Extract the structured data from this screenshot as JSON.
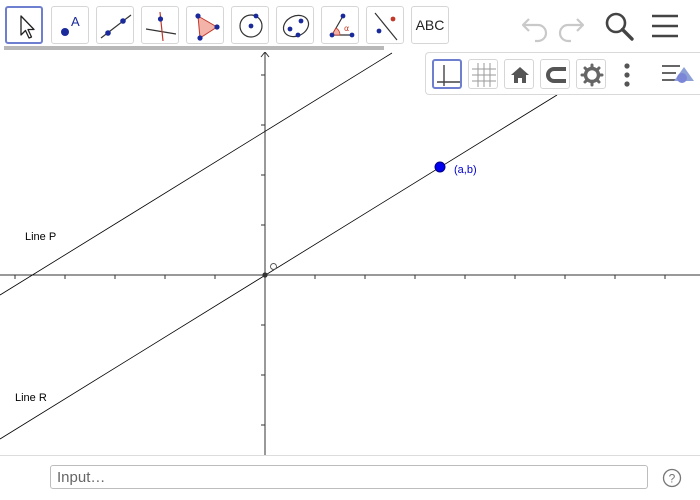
{
  "toolbar": {
    "tools": [
      {
        "name": "move-tool"
      },
      {
        "name": "point-tool"
      },
      {
        "name": "line-tool"
      },
      {
        "name": "perpendicular-line-tool"
      },
      {
        "name": "polygon-tool"
      },
      {
        "name": "circle-tool"
      },
      {
        "name": "conic-tool"
      },
      {
        "name": "angle-tool"
      },
      {
        "name": "reflect-tool"
      },
      {
        "name": "text-tool",
        "label": "ABC"
      }
    ],
    "point_tool_letter": "A",
    "angle_tool_symbol": "α"
  },
  "graphics": {
    "point_label": "(a,b)",
    "line_p_label": "Line P",
    "line_r_label": "Line R",
    "colors": {
      "point": "#0000ff",
      "axes": "#333333",
      "lines": "#000000"
    }
  },
  "input_bar": {
    "placeholder": "Input…"
  },
  "help": {
    "symbol": "?"
  }
}
